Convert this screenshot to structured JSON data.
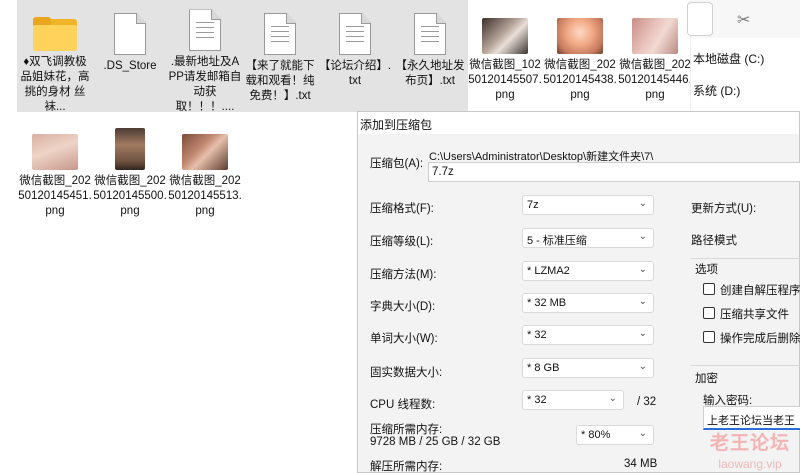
{
  "files_row1": [
    {
      "name": "♦双飞调教极品姐妹花，高挑的身材 丝袜...",
      "icon": "folder-icon",
      "selected": true
    },
    {
      "name": ".DS_Store",
      "icon": "file-icon",
      "selected": true
    },
    {
      "name": ".最新地址及APP请发邮箱自动获取！！！....",
      "icon": "file-icon",
      "selected": true
    },
    {
      "name": "【来了就能下载和观看！纯免费！】.txt",
      "icon": "file-icon",
      "selected": true
    },
    {
      "name": "【论坛介绍】.txt",
      "icon": "file-icon",
      "selected": true
    },
    {
      "name": "【永久地址发布页】.txt",
      "icon": "file-icon",
      "selected": true
    },
    {
      "name": "微信截图_10250120145507.png",
      "icon": "image-thumbnail",
      "selected": false
    },
    {
      "name": "微信截图_20250120145438.png",
      "icon": "image-thumbnail",
      "selected": false
    },
    {
      "name": "微信截图_20250120145446.png",
      "icon": "image-thumbnail",
      "selected": false
    }
  ],
  "files_row2": [
    {
      "name": "微信截图_20250120145451.png",
      "icon": "image-thumbnail"
    },
    {
      "name": "微信截图_20250120145500.png",
      "icon": "image-thumbnail"
    },
    {
      "name": "微信截图_20250120145513.png",
      "icon": "image-thumbnail"
    }
  ],
  "sidebar": {
    "drive_c": "本地磁盘 (C:)",
    "drive_d": "系统 (D:)",
    "cut_icon": "scissors-icon"
  },
  "dialog": {
    "title": "添加到压缩包",
    "archive_label": "压缩包(A):",
    "archive_path": "C:\\Users\\Administrator\\Desktop\\新建文件夹\\7\\",
    "archive_name": "7.7z",
    "format_label": "压缩格式(F):",
    "format_value": "7z",
    "level_label": "压缩等级(L):",
    "level_value": "5 - 标准压缩",
    "method_label": "压缩方法(M):",
    "method_value": "*  LZMA2",
    "dict_label": "字典大小(D):",
    "dict_value": "*  32 MB",
    "word_label": "单词大小(W):",
    "word_value": "*  32",
    "solid_label": "固实数据大小:",
    "solid_value": "*  8 GB",
    "cpu_label": "CPU 线程数:",
    "cpu_value": "*  32",
    "cpu_max": "/ 32",
    "mem_comp_label": "压缩所需内存:",
    "mem_comp_value": "9728 MB / 25 GB / 32 GB",
    "mem_percent": "*  80%",
    "mem_decomp_label": "解压所需内存:",
    "mem_decomp_value": "34 MB",
    "update_label": "更新方式(U):",
    "path_label": "路径模式",
    "options_label": "选项",
    "opt_sfx": "创建自解压程序(X",
    "opt_shared": "压缩共享文件",
    "opt_delete": "操作完成后删除源",
    "encrypt_label": "加密",
    "password_label": "输入密码:",
    "password_value": "上老王论坛当老王"
  },
  "watermark": {
    "main": "老王论坛",
    "sub": "laowang.vip"
  }
}
